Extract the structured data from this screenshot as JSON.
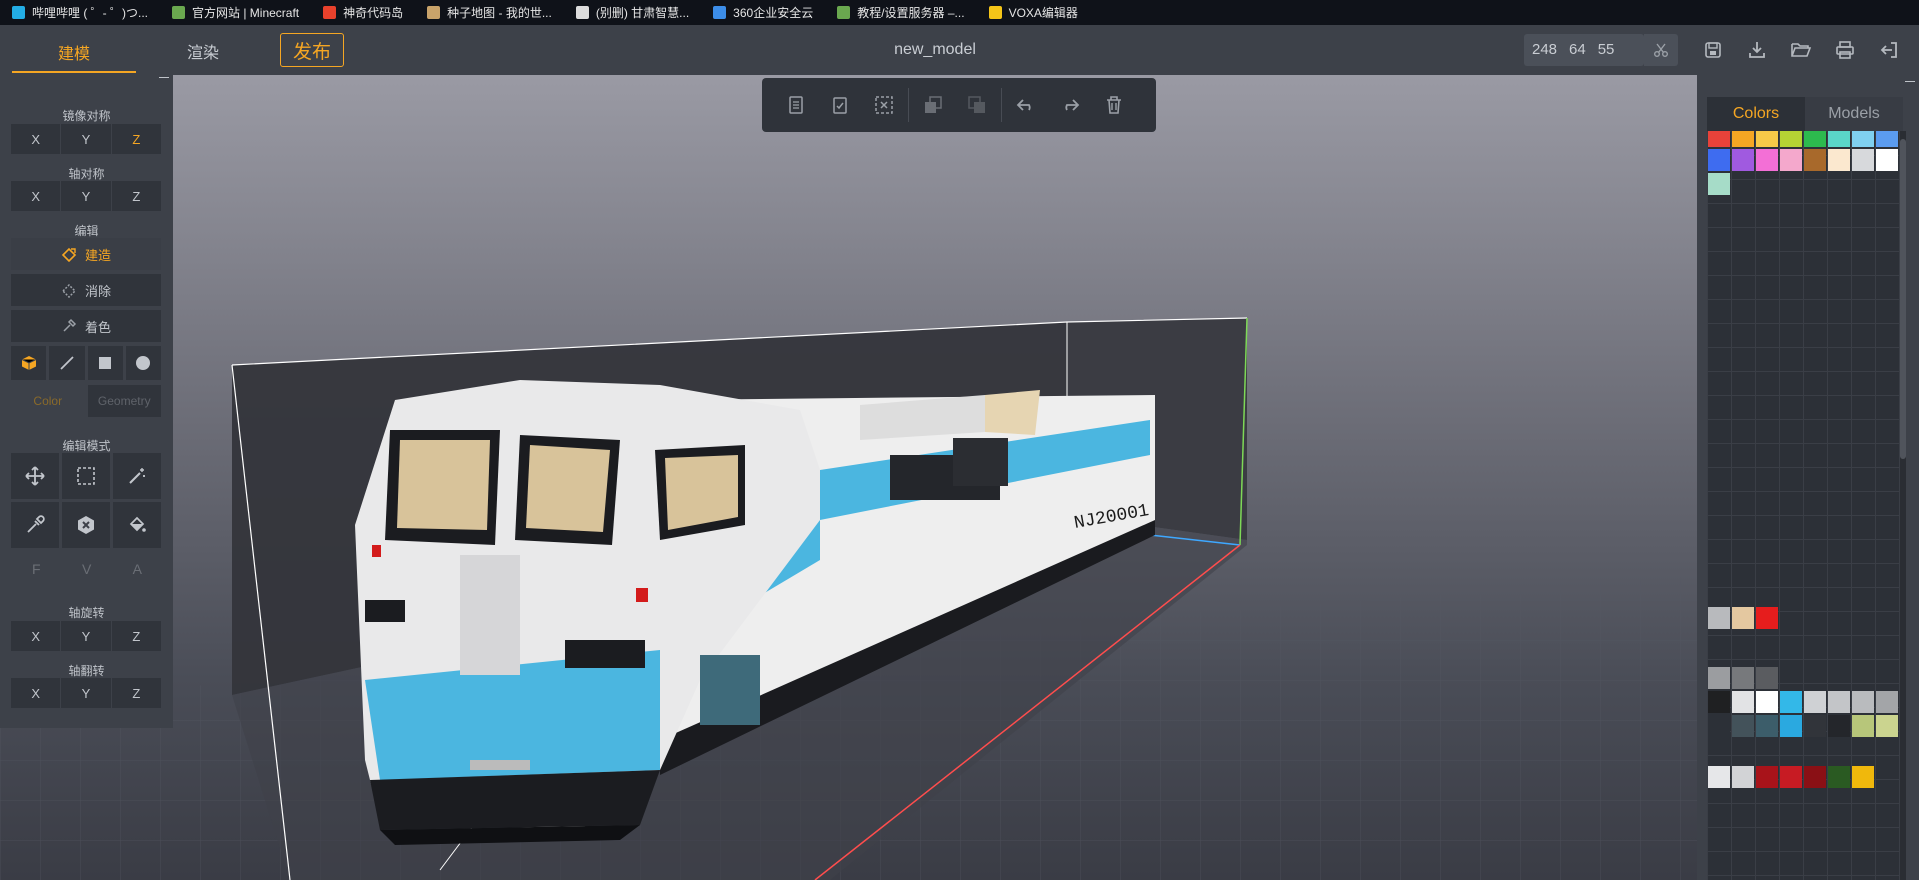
{
  "bookmarks": [
    {
      "label": "哔哩哔哩 ( ゜- ゜)つ...",
      "icon": "bilibili-icon",
      "color": "#23ade5"
    },
    {
      "label": "官方网站 | Minecraft",
      "icon": "minecraft-icon",
      "color": "#6aa84f"
    },
    {
      "label": "神奇代码岛",
      "icon": "codeisland-icon",
      "color": "#e8412c"
    },
    {
      "label": "种子地图 - 我的世...",
      "icon": "seedmap-icon",
      "color": "#c9a36a"
    },
    {
      "label": "(别删) 甘肃智慧...",
      "icon": "document-icon",
      "color": "#dddddd"
    },
    {
      "label": "360企业安全云",
      "icon": "360-icon",
      "color": "#3c8de8"
    },
    {
      "label": "教程/设置服务器 –...",
      "icon": "server-icon",
      "color": "#6aa84f"
    },
    {
      "label": "VOXA编辑器",
      "icon": "voxa-icon",
      "color": "#f5c518"
    }
  ],
  "header": {
    "tabs": {
      "model": "建模",
      "render": "渲染",
      "publish": "发布"
    },
    "title": "new_model",
    "coords": {
      "x": "248",
      "y": "64",
      "z": "55"
    }
  },
  "left_panel": {
    "mirror_label": "镜像对称",
    "axis_sym_label": "轴对称",
    "edit_label": "编辑",
    "build_label": "建造",
    "erase_label": "消除",
    "paint_label": "着色",
    "color_label": "Color",
    "geometry_label": "Geometry",
    "edit_mode_label": "编辑模式",
    "fva": [
      "F",
      "V",
      "A"
    ],
    "rotate_label": "轴旋转",
    "flip_label": "轴翻转",
    "axes": [
      "X",
      "Y",
      "Z"
    ]
  },
  "right_panel": {
    "tab_colors": "Colors",
    "tab_models": "Models"
  },
  "palette_swatches": [
    {
      "c": "#e8423a"
    },
    {
      "c": "#f5a623"
    },
    {
      "c": "#f7c948"
    },
    {
      "c": "#b5d334"
    },
    {
      "c": "#2dba4e"
    },
    {
      "c": "#5ad6c8"
    },
    {
      "c": "#7fd0f0"
    },
    {
      "c": "#5b9cf0"
    },
    {
      "c": "#3e6cf0"
    },
    {
      "c": "#a05ae0"
    },
    {
      "c": "#f36fd6"
    },
    {
      "c": "#f4a8cc"
    },
    {
      "c": "#a8692b"
    },
    {
      "c": "#fbe8cf"
    },
    {
      "c": "#d7d9dc"
    },
    {
      "c": "#ffffff"
    },
    {
      "c": "#a6dcc8"
    }
  ],
  "palette_swatches_lower": [
    {
      "c": "#b8babd"
    },
    {
      "c": "#e4c8a0"
    },
    {
      "c": "#e61d1d"
    }
  ],
  "palette_swatches_bottom": [
    {
      "c": "#9b9da0"
    },
    {
      "c": "#77797c"
    },
    {
      "c": "#5a5c60"
    },
    {
      "c": "#1f2022"
    },
    {
      "c": "#e2e3e5"
    },
    {
      "c": "#ffffff"
    },
    {
      "c": "#33b8e8"
    },
    {
      "c": "#cfd1d4"
    },
    {
      "c": "#c3c5c8"
    },
    {
      "c": "#b9bbbe"
    },
    {
      "c": "#a3a5a8"
    },
    {
      "c": "#2c3037"
    },
    {
      "c": "#43525a"
    },
    {
      "c": "#3c5d6a"
    },
    {
      "c": "#2aa9e0"
    },
    {
      "c": "#31343a"
    },
    {
      "c": "#24262b"
    },
    {
      "c": "#b7c67a"
    },
    {
      "c": "#cbd48f"
    },
    {
      "c": "#e6e7e9"
    },
    {
      "c": "#d2d3d6"
    },
    {
      "c": "#a8131a"
    },
    {
      "c": "#c71b23"
    },
    {
      "c": "#8a1015"
    },
    {
      "c": "#2a5a22"
    },
    {
      "c": "#f0b80c"
    }
  ]
}
